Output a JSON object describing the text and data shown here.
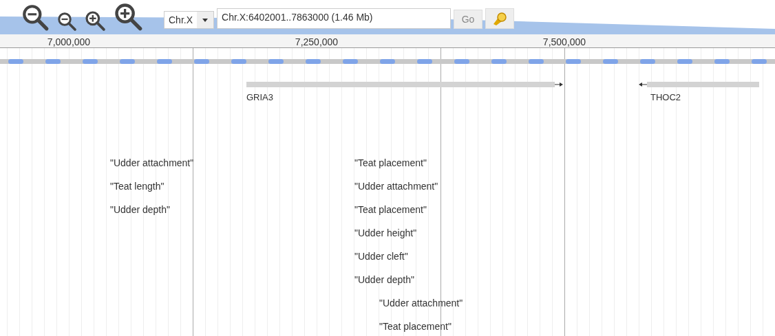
{
  "toolbar": {
    "chromosome": "Chr.X",
    "location": "Chr.X:6402001..7863000 (1.46 Mb)",
    "go": "Go"
  },
  "ruler": {
    "ticks": [
      "7,000,000",
      "7,250,000",
      "7,500,000"
    ]
  },
  "genes": [
    {
      "name": "GRIA3",
      "forward_strand": true
    },
    {
      "name": "THOC2",
      "forward_strand": false
    }
  ],
  "qtl_groups": [
    {
      "labels": [
        "\"Udder attachment\"",
        "\"Teat length\"",
        "\"Udder depth\""
      ]
    },
    {
      "labels": [
        "\"Teat placement\"",
        "\"Udder attachment\"",
        "\"Teat placement\"",
        "\"Udder height\"",
        "\"Udder cleft\"",
        "\"Udder depth\""
      ]
    },
    {
      "labels": [
        "\"Udder attachment\"",
        "\"Teat placement\""
      ]
    }
  ]
}
